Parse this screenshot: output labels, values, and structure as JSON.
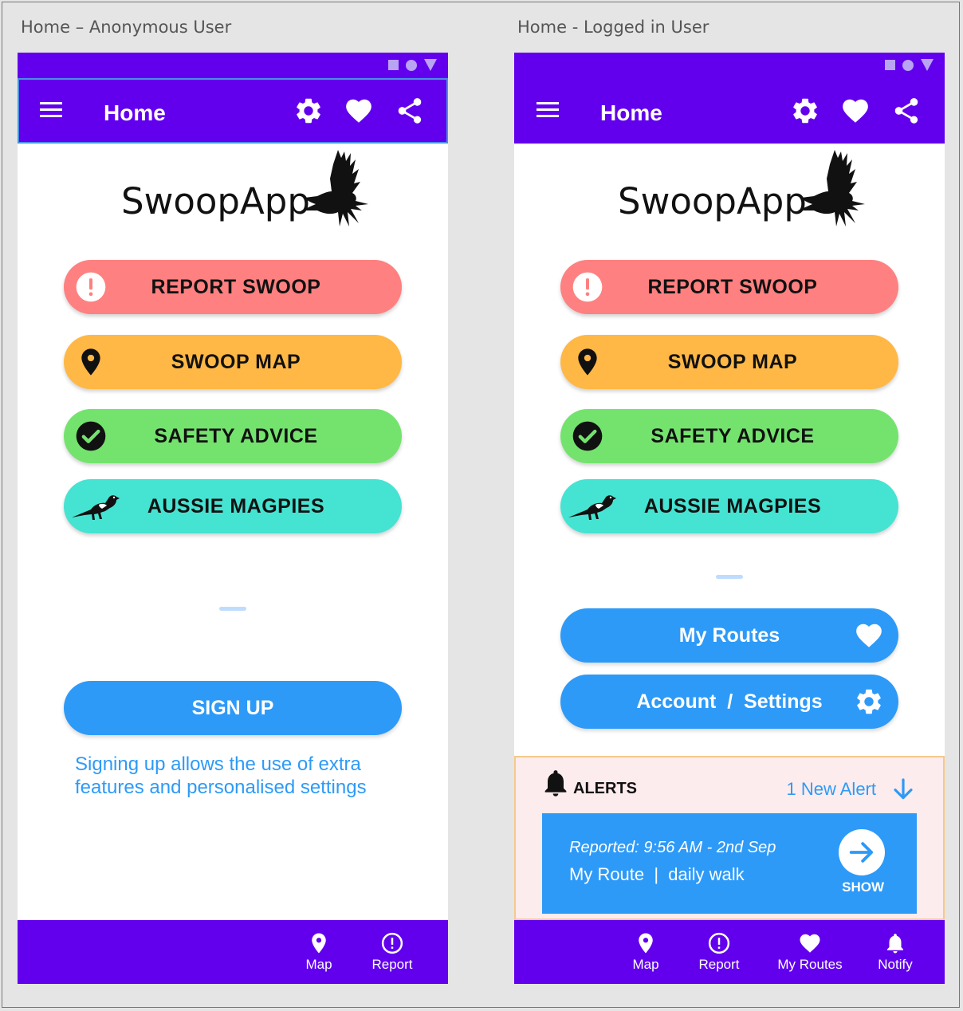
{
  "canvas": {
    "labels": {
      "anonymous": "Home – Anonymous User",
      "logged_in": "Home - Logged in User"
    }
  },
  "colors": {
    "primary": "#6200ee",
    "report": "#ff8080",
    "map": "#ffb845",
    "safety": "#74e36e",
    "magpies": "#45e3d2",
    "blue": "#2d9af8"
  },
  "app_bar": {
    "title": "Home",
    "icons": [
      "menu-icon",
      "settings-icon",
      "heart-icon",
      "share-icon"
    ]
  },
  "logo": {
    "text": "SwoopApp",
    "icon": "crow-icon"
  },
  "menu": {
    "report": "REPORT SWOOP",
    "map": "SWOOP MAP",
    "safety": "SAFETY ADVICE",
    "magpies": "AUSSIE MAGPIES"
  },
  "anonymous": {
    "signup_label": "SIGN UP",
    "signup_info": "Signing up allows the use of extra features and personalised settings",
    "nav": [
      {
        "label": "Map",
        "icon": "map-pin-icon"
      },
      {
        "label": "Report",
        "icon": "alert-circle-icon"
      }
    ]
  },
  "logged_in": {
    "my_routes": "My Routes",
    "account_settings": "Account  /  Settings",
    "alerts": {
      "title": "ALERTS",
      "count_text": "1 New Alert",
      "card": {
        "time": "Reported: 9:56 AM - 2nd Sep",
        "route": "My Route  |  daily walk",
        "show_label": "SHOW"
      }
    },
    "nav": [
      {
        "label": "Map",
        "icon": "map-pin-icon"
      },
      {
        "label": "Report",
        "icon": "alert-circle-icon"
      },
      {
        "label": "My Routes",
        "icon": "heart-icon"
      },
      {
        "label": "Notify",
        "icon": "bell-icon"
      }
    ]
  }
}
